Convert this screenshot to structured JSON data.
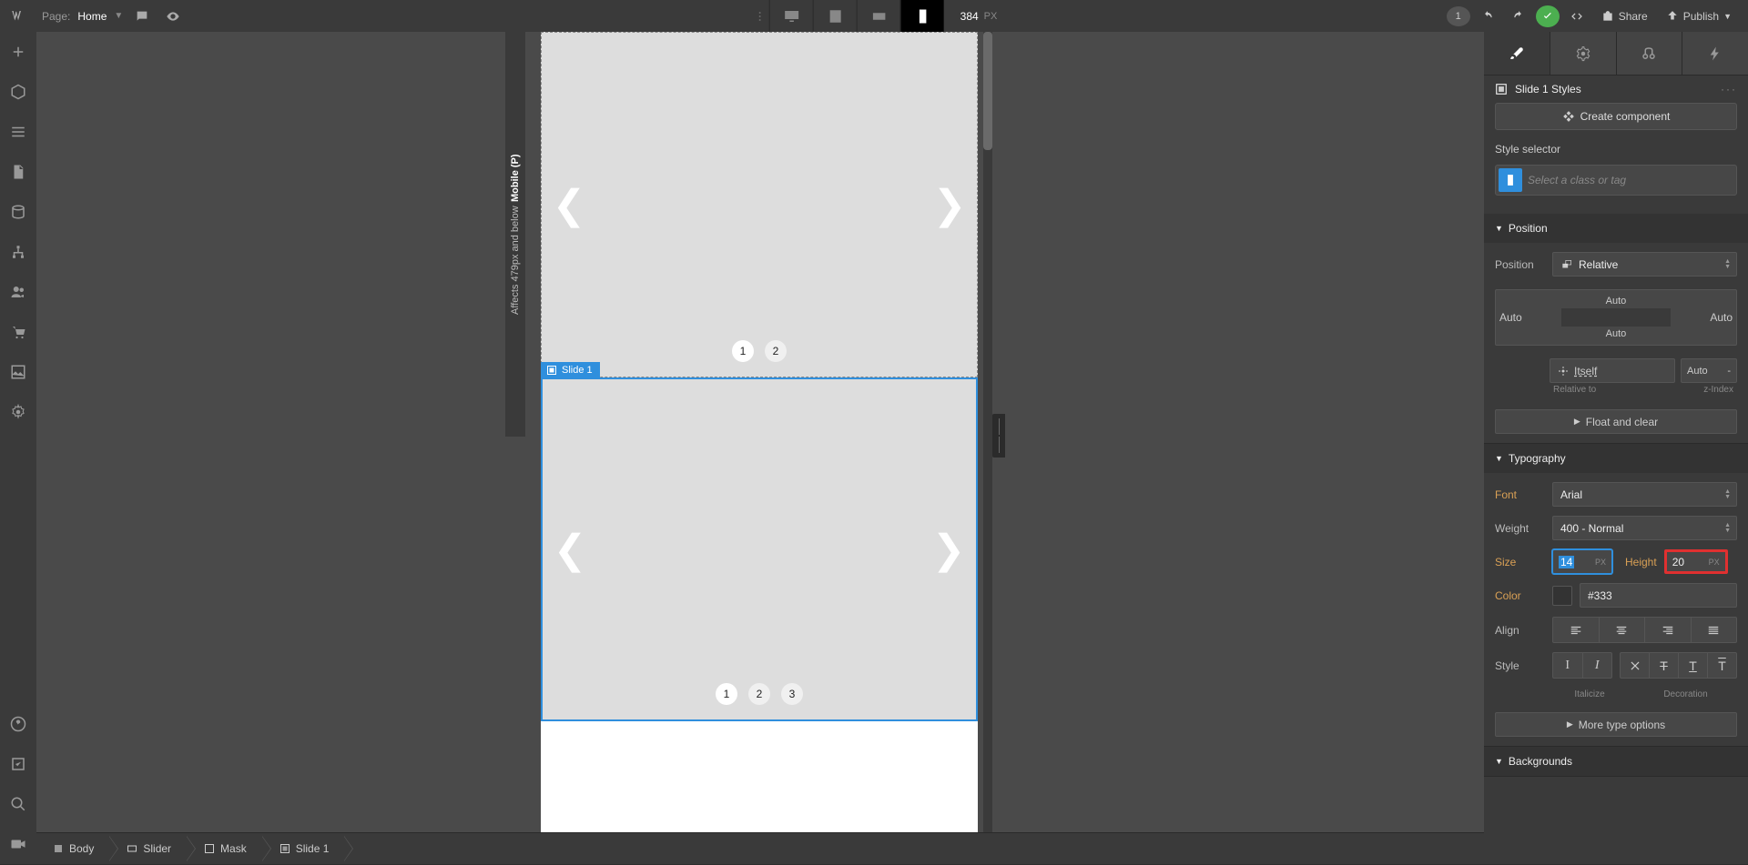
{
  "topbar": {
    "page_label": "Page:",
    "page_name": "Home",
    "width_value": "384",
    "width_unit": "PX",
    "changes_count": "1",
    "share_label": "Share",
    "publish_label": "Publish"
  },
  "breadcrumb": {
    "items": [
      "Body",
      "Slider",
      "Mask",
      "Slide 1"
    ]
  },
  "breakpoint": {
    "label": "Affects 479px and below",
    "name": "Mobile (P)"
  },
  "canvas": {
    "slider_top": {
      "dots": [
        "1",
        "2"
      ]
    },
    "selected_label": "Slide 1",
    "slider_bot": {
      "dots": [
        "1",
        "2",
        "3"
      ]
    }
  },
  "panel": {
    "styles_title": "Slide 1 Styles",
    "create_component": "Create component",
    "style_selector_label": "Style selector",
    "style_selector_placeholder": "Select a class or tag",
    "sections": {
      "position": {
        "title": "Position",
        "position_label": "Position",
        "position_value": "Relative",
        "auto": "Auto",
        "relative_to": "Relative to",
        "relative_to_value": "Itself",
        "zindex_label": "z-Index",
        "zindex_value": "Auto",
        "zindex_sep": "-",
        "float_clear": "Float and clear"
      },
      "typography": {
        "title": "Typography",
        "font_label": "Font",
        "font_value": "Arial",
        "weight_label": "Weight",
        "weight_value": "400 - Normal",
        "size_label": "Size",
        "size_value": "14",
        "size_unit": "PX",
        "height_label": "Height",
        "height_value": "20",
        "height_unit": "PX",
        "color_label": "Color",
        "color_value": "#333",
        "align_label": "Align",
        "style_label": "Style",
        "italicize_label": "Italicize",
        "decoration_label": "Decoration",
        "more_options": "More type options"
      },
      "backgrounds": {
        "title": "Backgrounds"
      }
    }
  }
}
